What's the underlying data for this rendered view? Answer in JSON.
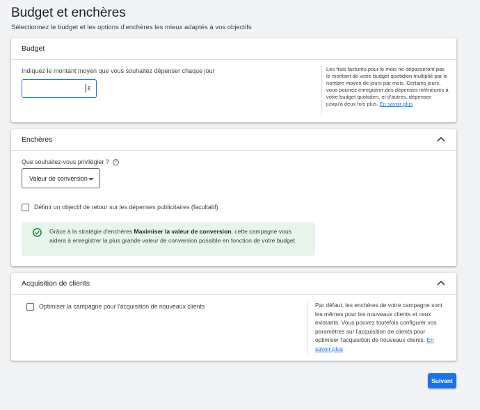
{
  "page": {
    "title": "Budget et enchères",
    "subtitle": "Sélectionnez le budget et les options d'enchères les mieux adaptés à vos objectifs"
  },
  "budget": {
    "header": "Budget",
    "label": "Indiquez le montant moyen que vous souhaitez dépenser chaque jour",
    "input_value": "",
    "currency": "€",
    "note_text": "Les frais facturés pour le mois ne dépasseront pas le montant de votre budget quotidien multiplié par le nombre moyen de jours par mois. Certains jours, vous pourrez enregistrer des dépenses inférieures à votre budget quotidien, et d'autres, dépenser jusqu'à deux fois plus.",
    "note_link": "En savoir plus"
  },
  "bids": {
    "header": "Enchères",
    "question": "Que souhaitez-vous privilégier ?",
    "help_icon_glyph": "?",
    "select_value": "Valeur de conversion",
    "target_checkbox_label": "Définir un objectif de retour sur les dépenses publicitaires (facultatif)",
    "target_checked": false,
    "info_prefix": "Grâce à la stratégie d'enchères ",
    "info_bold": "Maximiser la valeur de conversion",
    "info_suffix": ", cette campagne vous aidera à enregistrer la plus grande valeur de conversion possible en fonction de votre budget"
  },
  "acquisition": {
    "header": "Acquisition de clients",
    "checkbox_label": "Optimiser la campagne pour l'acquisition de nouveaux clients",
    "checked": false,
    "note_text": "Par défaut, les enchères de votre campagne sont les mêmes pour les nouveaux clients et ceux existants. Vous pouvez toutefois configurer vos paramètres sur l'acquisition de clients pour optimiser l'acquisition de nouveaux clients.",
    "note_link": "En savoir plus"
  },
  "actions": {
    "next_label": "Suivant"
  },
  "icons": {
    "chevron": "chevron-up-icon",
    "info_check": "check-circle-icon",
    "dropdown": "arrow-drop-down-icon"
  },
  "colors": {
    "accent": "#1a73e8",
    "success": "#188038",
    "info_bg": "#e6f4ea"
  }
}
